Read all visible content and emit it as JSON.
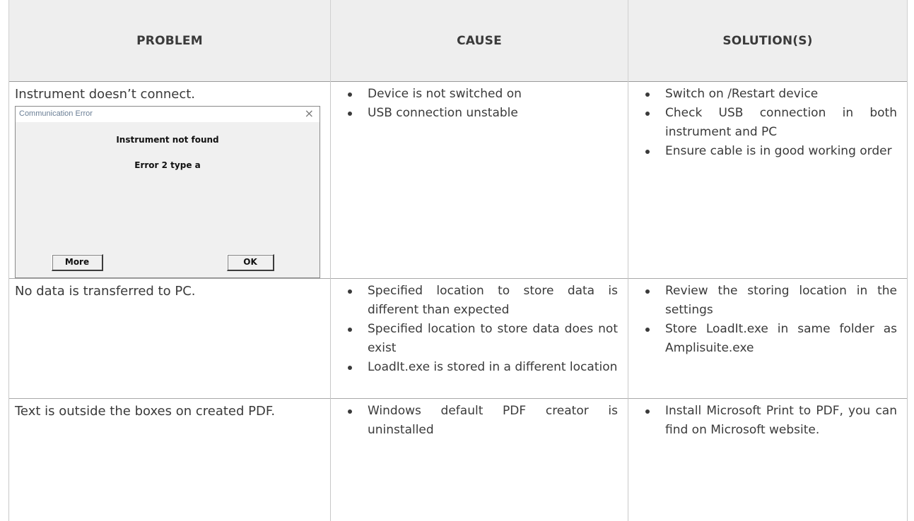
{
  "table": {
    "headers": {
      "problem": "PROBLEM",
      "cause": "CAUSE",
      "solutions": "SOLUTION(S)"
    },
    "rows": [
      {
        "problem": "Instrument doesn’t connect.",
        "causes": [
          "Device is not switched on",
          "USB connection unstable"
        ],
        "solutions": [
          "Switch on /Restart device",
          "Check USB connection in both instrument and PC",
          "Ensure cable is in good working order"
        ]
      },
      {
        "problem": "No data is transferred to PC.",
        "causes": [
          "Specified location to store data is different than expected",
          "Specified location to store data does not exist",
          "LoadIt.exe is stored in a different location"
        ],
        "solutions": [
          "Review the storing location in the settings",
          "Store LoadIt.exe in same folder as Amplisuite.exe"
        ]
      },
      {
        "problem": "Text is outside the boxes on created PDF.",
        "causes": [
          "Windows default PDF creator is uninstalled"
        ],
        "solutions": [
          "Install Microsoft Print to PDF, you can find on Microsoft website."
        ]
      }
    ]
  },
  "dialog": {
    "title": "Communication Error",
    "close_glyph": "×",
    "message": "Instrument not found",
    "error_code": "Error 2 type a",
    "more_label": "More",
    "ok_label": "OK"
  },
  "colors": {
    "header_bg": "#eeeeee",
    "text": "#3a3a3a",
    "dialog_bg": "#f0f0f0",
    "dialog_title": "#6a7e95"
  },
  "icons": {
    "bullet": "bullet-dot-icon",
    "close": "close-icon"
  }
}
